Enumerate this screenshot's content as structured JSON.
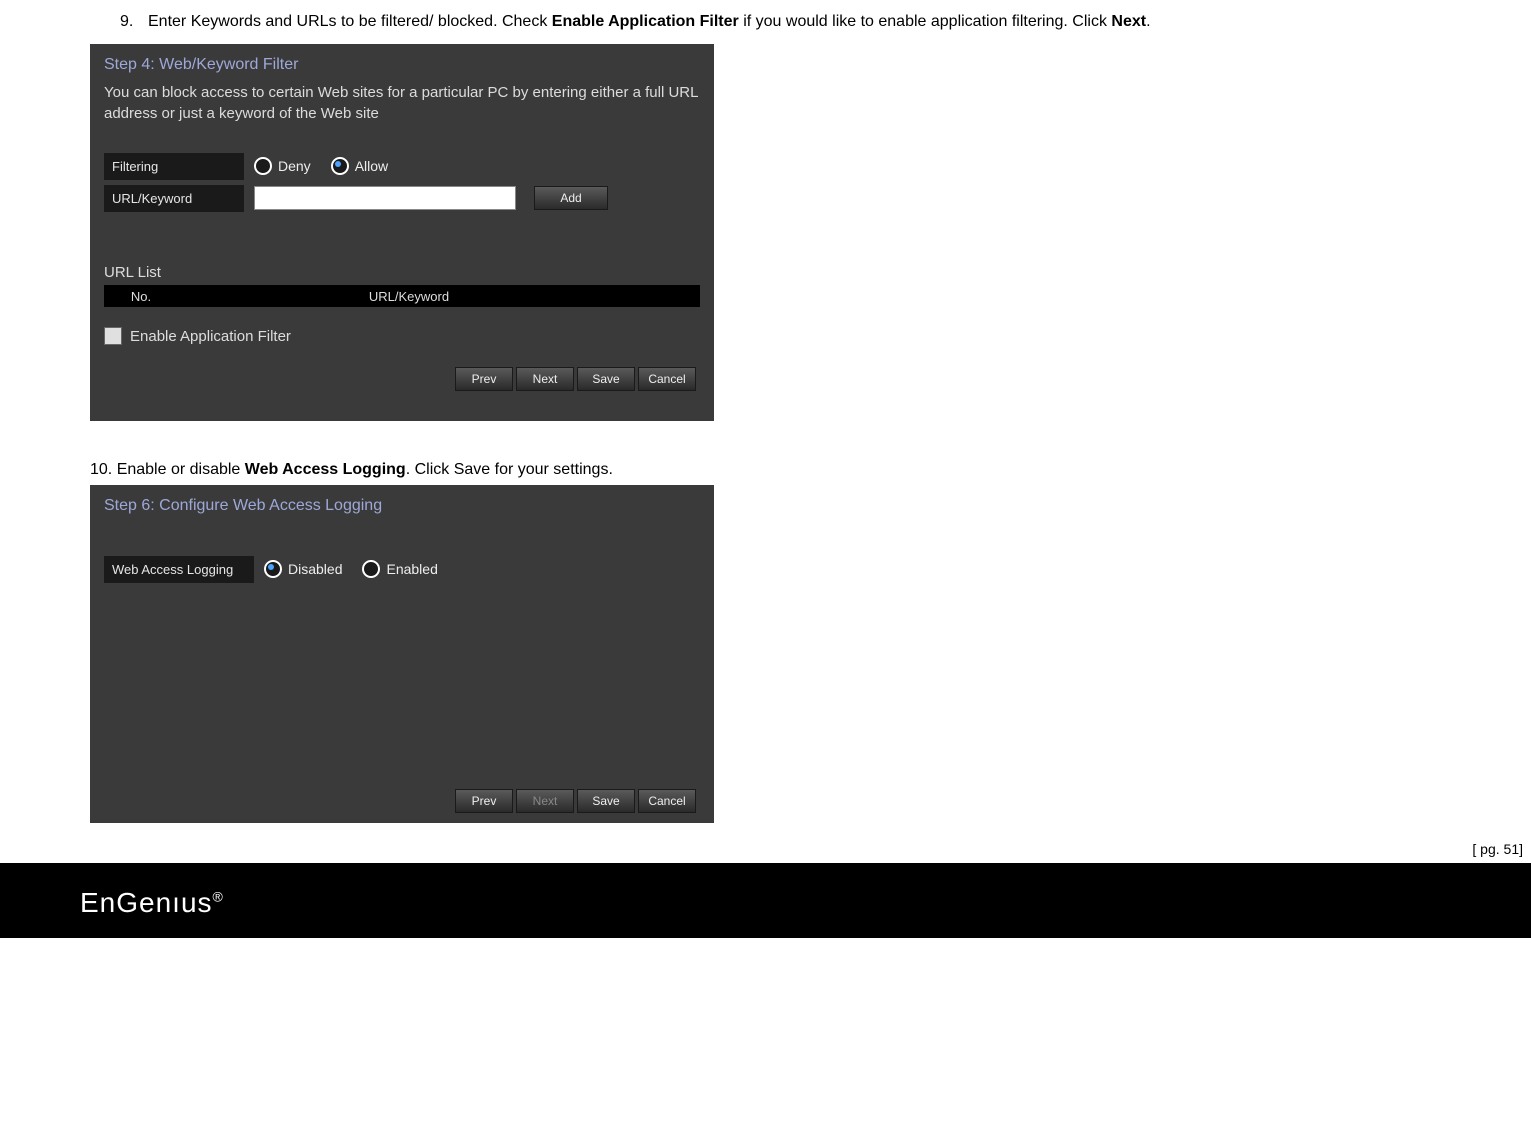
{
  "step9": {
    "num": "9.",
    "text_pre": "Enter Keywords and URLs to be filtered/ blocked. Check ",
    "bold1": "Enable Application Filter",
    "text_mid": " if you would like to enable application filtering. Click ",
    "bold2": "Next",
    "text_post": "."
  },
  "panel1": {
    "title": "Step 4: Web/Keyword Filter",
    "desc": "You can block access to certain Web sites for a particular PC by entering either a full URL address or just a keyword of the Web site",
    "filtering_label": "Filtering",
    "url_keyword_label": "URL/Keyword",
    "deny": "Deny",
    "allow": "Allow",
    "add": "Add",
    "url_list_label": "URL List",
    "col_no": "No.",
    "col_url": "URL/Keyword",
    "enable_app_filter": "Enable Application Filter",
    "buttons": {
      "prev": "Prev",
      "next": "Next",
      "save": "Save",
      "cancel": "Cancel"
    }
  },
  "step10": {
    "text_pre": "10. Enable or disable ",
    "bold1": "Web Access Logging",
    "text_post": ". Click Save for your settings."
  },
  "panel2": {
    "title": "Step 6: Configure Web Access Logging",
    "web_access_label": "Web Access Logging",
    "disabled": "Disabled",
    "enabled": "Enabled",
    "buttons": {
      "prev": "Prev",
      "next": "Next",
      "save": "Save",
      "cancel": "Cancel"
    }
  },
  "footer": {
    "page_num": "[ pg. 51]",
    "logo": "EnGenıus",
    "reg": "®"
  }
}
